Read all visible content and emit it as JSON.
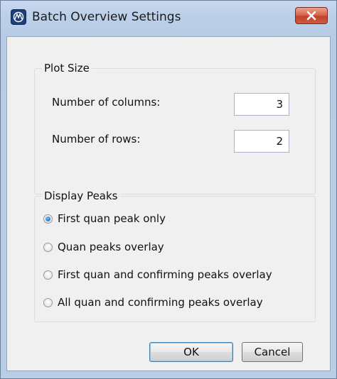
{
  "window": {
    "title": "Batch Overview Settings",
    "app_icon": "waveform-logo-icon",
    "close_icon": "close-icon"
  },
  "plot_size": {
    "legend": "Plot Size",
    "columns_label": "Number of columns:",
    "columns_value": "3",
    "rows_label": "Number of rows:",
    "rows_value": "2"
  },
  "display_peaks": {
    "legend": "Display Peaks",
    "selected": 0,
    "options": [
      {
        "label": "First quan peak only"
      },
      {
        "label": "Quan peaks overlay"
      },
      {
        "label": "First quan and confirming peaks overlay"
      },
      {
        "label": "All quan and confirming peaks overlay"
      }
    ]
  },
  "buttons": {
    "ok": "OK",
    "cancel": "Cancel"
  },
  "colors": {
    "title_bar": "#bcd0ea",
    "client_bg": "#f0f0f0",
    "close_button": "#c94f36",
    "radio_selected": "#2f7fd0"
  }
}
